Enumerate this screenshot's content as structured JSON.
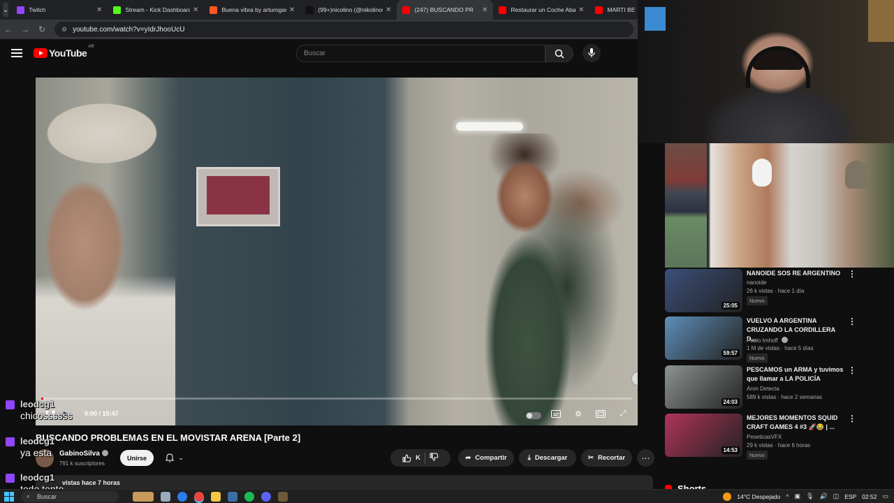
{
  "browser": {
    "tabs": [
      {
        "title": "Twitch",
        "color": "#9146ff",
        "active": false
      },
      {
        "title": "Stream - Kick Dashboard",
        "color": "#53fc18",
        "active": false
      },
      {
        "title": "Buena vibra by arturogar",
        "color": "#ff5722",
        "active": false
      },
      {
        "title": "(99+)nicolino (@nikolinou",
        "color": "#111111",
        "active": false
      },
      {
        "title": "(247) BUSCANDO PR",
        "color": "#ff0000",
        "active": true
      },
      {
        "title": "Restaurar un Coche Aban",
        "color": "#ff0000",
        "active": false
      },
      {
        "title": "MARTI BE",
        "color": "#ff0000",
        "active": false
      }
    ],
    "url": "youtube.com/watch?v=yIdrJhooUcU"
  },
  "youtube": {
    "logo_text": "YouTube",
    "country_code": "AR",
    "search_placeholder": "Buscar"
  },
  "player": {
    "time": "0:00 / 15:47",
    "progress_fraction": 0.003
  },
  "video": {
    "title": "BUSCANDO PROBLEMAS EN EL MOVISTAR ARENA [Parte 2]",
    "channel": "GabinoSilva",
    "subscribers": "791 k suscriptores",
    "join_label": "Unirse",
    "like_count": "K",
    "share_label": "Compartir",
    "download_label": "Descargar",
    "clip_label": "Recortar",
    "description_meta": "vistas  hace 7 horas"
  },
  "related": [
    {
      "title": "NANOIDE SOS RE ARGENTINO",
      "channel": "nanoide",
      "stats": "26 k vistas · hace 1 día",
      "duration": "25:05",
      "badge": "Nuevo",
      "thumb_color": "#3b4f7a",
      "verified": false
    },
    {
      "title": "VUELVO A ARGENTINA CRUZANDO LA CORDILLERA D...",
      "channel": "Pablo Imhoff",
      "stats": "1 M de vistas · hace 5 días",
      "duration": "59:57",
      "badge": "Nuevo",
      "thumb_color": "#5e8fb8",
      "verified": true
    },
    {
      "title": "PESCAMOS un ARMA y tuvimos que llamar a LA POLICÍA",
      "channel": "Aron Detecta",
      "stats": "589 k vistas · hace 2 semanas",
      "duration": "24:03",
      "badge": "",
      "thumb_color": "#8d9490",
      "verified": false
    },
    {
      "title": "MEJORES MOMENTOS SQUID CRAFT GAMES 4 #3 🚀😂 | ...",
      "channel": "PeseticasVFX",
      "stats": "29 k vistas · hace 6 horas",
      "duration": "14:53",
      "badge": "Nuevo",
      "thumb_color": "#b0345a",
      "verified": false
    }
  ],
  "shorts_label": "Shorts",
  "chat": [
    {
      "user": "leodcg1",
      "message": "chicossssss"
    },
    {
      "user": "leodcg1",
      "message": "ya esta"
    },
    {
      "user": "leodcg1",
      "message": "todo tonto"
    }
  ],
  "taskbar": {
    "search_label": "Buscar",
    "weather": "14°C  Despejado",
    "language": "ESP",
    "clock": "02:52"
  }
}
